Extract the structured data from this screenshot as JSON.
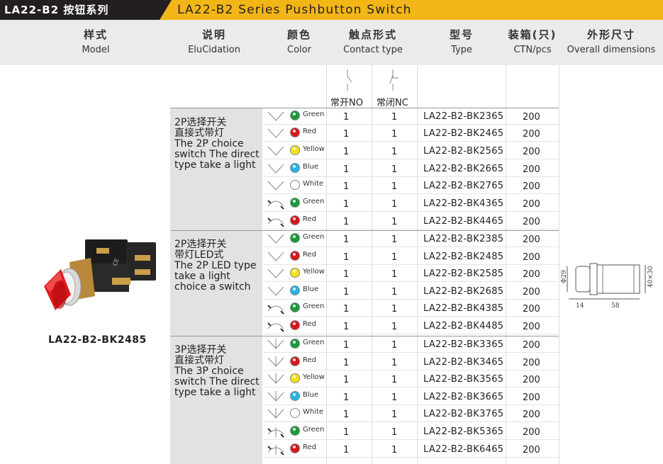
{
  "title": {
    "left": "LA22-B2 按钮系列",
    "right": "LA22-B2 Series Pushbutton Switch"
  },
  "header": {
    "model": {
      "cn": "样式",
      "en": "Model"
    },
    "desc": {
      "cn": "说明",
      "en": "EluCidation"
    },
    "color": {
      "cn": "颜色",
      "en": "Color"
    },
    "contact": {
      "cn": "触点形式",
      "en": "Contact  type"
    },
    "type": {
      "cn": "型号",
      "en": "Type"
    },
    "ctn": {
      "cn": "装箱(只)",
      "en": "CTN/pcs"
    },
    "dims": {
      "cn": "外形尺寸",
      "en": "Overall dimensions"
    }
  },
  "contact_labels": {
    "no": "常开NO",
    "nc": "常闭NC"
  },
  "groups": [
    {
      "cn1": "2P选择开关",
      "cn2": "直接式带灯",
      "en1": "The 2P choice",
      "en2": "switch The direct",
      "en3": "type take a light"
    },
    {
      "cn1": "2P选择开关",
      "cn2": "带灯LED式",
      "en1": "The 2P LED type",
      "en2": "take a light",
      "en3": "choice a switch"
    },
    {
      "cn1": "3P选择开关",
      "cn2": "直接式带灯",
      "en1": "The 3P choice",
      "en2": "switch The direct",
      "en3": "type take a light"
    }
  ],
  "rows": [
    {
      "sym": "v2",
      "color": "Green",
      "hex": "#1a9a3a",
      "no": "1",
      "nc": "1",
      "type": "LA22-B2-BK2365",
      "ctn": "200"
    },
    {
      "sym": "v2",
      "color": "Red",
      "hex": "#d8161c",
      "no": "1",
      "nc": "1",
      "type": "LA22-B2-BK2465",
      "ctn": "200"
    },
    {
      "sym": "v2",
      "color": "Yellow",
      "hex": "#f5e21a",
      "no": "1",
      "nc": "1",
      "type": "LA22-B2-BK2565",
      "ctn": "200"
    },
    {
      "sym": "v2",
      "color": "Blue",
      "hex": "#27b3e6",
      "no": "1",
      "nc": "1",
      "type": "LA22-B2-BK2665",
      "ctn": "200"
    },
    {
      "sym": "v2",
      "color": "White",
      "hex": "#ffffff",
      "no": "1",
      "nc": "1",
      "type": "LA22-B2-BK2765",
      "ctn": "200"
    },
    {
      "sym": "arc",
      "color": "Green",
      "hex": "#1a9a3a",
      "no": "1",
      "nc": "1",
      "type": "LA22-B2-BK4365",
      "ctn": "200"
    },
    {
      "sym": "arc",
      "color": "Red",
      "hex": "#d8161c",
      "no": "1",
      "nc": "1",
      "type": "LA22-B2-BK4465",
      "ctn": "200"
    },
    {
      "sym": "v2",
      "color": "Green",
      "hex": "#1a9a3a",
      "no": "1",
      "nc": "1",
      "type": "LA22-B2-BK2385",
      "ctn": "200"
    },
    {
      "sym": "v2",
      "color": "Red",
      "hex": "#d8161c",
      "no": "1",
      "nc": "1",
      "type": "LA22-B2-BK2485",
      "ctn": "200"
    },
    {
      "sym": "v2",
      "color": "Yellow",
      "hex": "#f5e21a",
      "no": "1",
      "nc": "1",
      "type": "LA22-B2-BK2585",
      "ctn": "200"
    },
    {
      "sym": "v2",
      "color": "Blue",
      "hex": "#27b3e6",
      "no": "1",
      "nc": "1",
      "type": "LA22-B2-BK2685",
      "ctn": "200"
    },
    {
      "sym": "arc",
      "color": "Green",
      "hex": "#1a9a3a",
      "no": "1",
      "nc": "1",
      "type": "LA22-B2-BK4385",
      "ctn": "200"
    },
    {
      "sym": "arc",
      "color": "Red",
      "hex": "#d8161c",
      "no": "1",
      "nc": "1",
      "type": "LA22-B2-BK4485",
      "ctn": "200"
    },
    {
      "sym": "v3",
      "color": "Green",
      "hex": "#1a9a3a",
      "no": "1",
      "nc": "1",
      "type": "LA22-B2-BK3365",
      "ctn": "200"
    },
    {
      "sym": "v3",
      "color": "Red",
      "hex": "#d8161c",
      "no": "1",
      "nc": "1",
      "type": "LA22-B2-BK3465",
      "ctn": "200"
    },
    {
      "sym": "v3",
      "color": "Yellow",
      "hex": "#f5e21a",
      "no": "1",
      "nc": "1",
      "type": "LA22-B2-BK3565",
      "ctn": "200"
    },
    {
      "sym": "v3",
      "color": "Blue",
      "hex": "#27b3e6",
      "no": "1",
      "nc": "1",
      "type": "LA22-B2-BK3665",
      "ctn": "200"
    },
    {
      "sym": "v3",
      "color": "White",
      "hex": "#ffffff",
      "no": "1",
      "nc": "1",
      "type": "LA22-B2-BK3765",
      "ctn": "200"
    },
    {
      "sym": "arc3",
      "color": "Green",
      "hex": "#1a9a3a",
      "no": "1",
      "nc": "1",
      "type": "LA22-B2-BK5365",
      "ctn": "200"
    },
    {
      "sym": "arc3",
      "color": "Red",
      "hex": "#d8161c",
      "no": "1",
      "nc": "1",
      "type": "LA22-B2-BK6465",
      "ctn": "200"
    }
  ],
  "product": {
    "caption": "LA22-B2-BK2485",
    "label": "CE"
  },
  "dimensions": {
    "d1": "Φ29",
    "d2": "40×30",
    "w1": "14",
    "w2": "58"
  }
}
